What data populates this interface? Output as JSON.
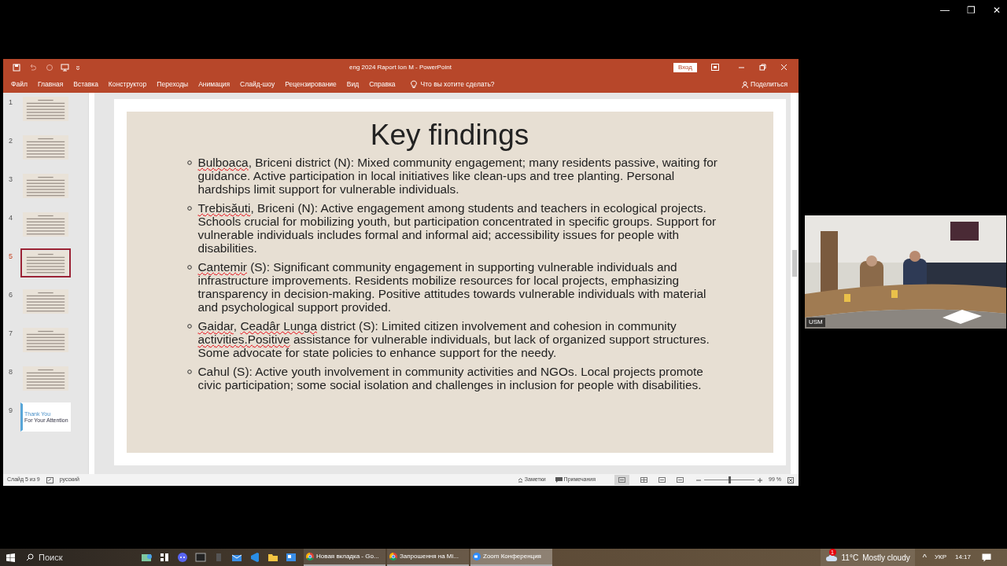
{
  "zoom_controls": [
    "—",
    "❐",
    "✕"
  ],
  "window": {
    "title": "eng 2024 Raport Ion M  -  PowerPoint",
    "sign_in": "Вход",
    "share": "Поделиться"
  },
  "ribbon_tabs": [
    {
      "label": "Файл"
    },
    {
      "label": "Главная"
    },
    {
      "label": "Вставка"
    },
    {
      "label": "Конструктор"
    },
    {
      "label": "Переходы"
    },
    {
      "label": "Анимация"
    },
    {
      "label": "Слайд-шоу"
    },
    {
      "label": "Рецензирование"
    },
    {
      "label": "Вид"
    },
    {
      "label": "Справка"
    }
  ],
  "tell_me": "Что вы хотите сделать?",
  "thumbnails": [
    {
      "number": "1",
      "kind": "text",
      "selected": false
    },
    {
      "number": "2",
      "kind": "text",
      "selected": false
    },
    {
      "number": "3",
      "kind": "text",
      "selected": false
    },
    {
      "number": "4",
      "kind": "text",
      "selected": false
    },
    {
      "number": "5",
      "kind": "text",
      "selected": true
    },
    {
      "number": "6",
      "kind": "text",
      "selected": false
    },
    {
      "number": "7",
      "kind": "text",
      "selected": false
    },
    {
      "number": "8",
      "kind": "text",
      "selected": false
    },
    {
      "number": "9",
      "kind": "closing",
      "selected": false,
      "lines": [
        "Thank You",
        "For Your Attention"
      ]
    }
  ],
  "slide": {
    "title": "Key findings",
    "bullets": [
      [
        {
          "text": "Bulboaca",
          "misspelled": true
        },
        {
          "text": ", Briceni district (N): Mixed community engagement; many residents passive, waiting for guidance. Active participation in local initiatives like clean-ups and tree planting. Personal hardships limit support for vulnerable individuals.",
          "misspelled": false
        }
      ],
      [
        {
          "text": "Trebisăuti",
          "misspelled": true
        },
        {
          "text": ", Briceni (N): Active engagement among students and teachers in ecological projects. Schools crucial for mobilizing youth, but participation concentrated in specific groups. Support for vulnerable individuals includes formal and informal aid; accessibility issues for people with disabilities.",
          "misspelled": false
        }
      ],
      [
        {
          "text": "Cantemir",
          "misspelled": true
        },
        {
          "text": " (S): Significant community engagement in supporting vulnerable individuals and infrastructure improvements. Residents mobilize resources for local projects, emphasizing transparency in decision-making. Positive attitudes towards vulnerable individuals with material and psychological support provided.",
          "misspelled": false
        }
      ],
      [
        {
          "text": "Gaidar",
          "misspelled": true
        },
        {
          "text": ", ",
          "misspelled": false
        },
        {
          "text": "Ceadâr Lunga",
          "misspelled": true
        },
        {
          "text": " district (S): Limited citizen involvement and cohesion in community ",
          "misspelled": false
        },
        {
          "text": "activities.Positive",
          "misspelled": true
        },
        {
          "text": " assistance for vulnerable individuals, but lack of organized support structures. Some advocate for state policies to enhance support for the needy.",
          "misspelled": false
        }
      ],
      [
        {
          "text": "Cahul (S): Active youth involvement in community activities and NGOs. Local projects promote civic participation; some social isolation and challenges in inclusion for people with disabilities.",
          "misspelled": false
        }
      ]
    ]
  },
  "status_bar": {
    "slide": "Слайд 5 из 9",
    "language": "русский",
    "notes": "Заметки",
    "comments": "Примечания",
    "zoom": "99 %",
    "zoom_slider": {
      "level": 0.5
    }
  },
  "video": {
    "label": "USM"
  },
  "taskbar": {
    "search": "Поиск",
    "windows": [
      {
        "label": "Новая вкладка - Go...",
        "selected": false
      },
      {
        "label": "Запрошення на Mi...",
        "selected": false
      },
      {
        "label": "Zoom Конференция",
        "selected": true
      }
    ],
    "weather_badge": "1",
    "temperature": "11°C",
    "weather": "Mostly cloudy",
    "chevron": "^",
    "language": "УКР",
    "time": "14:17"
  }
}
